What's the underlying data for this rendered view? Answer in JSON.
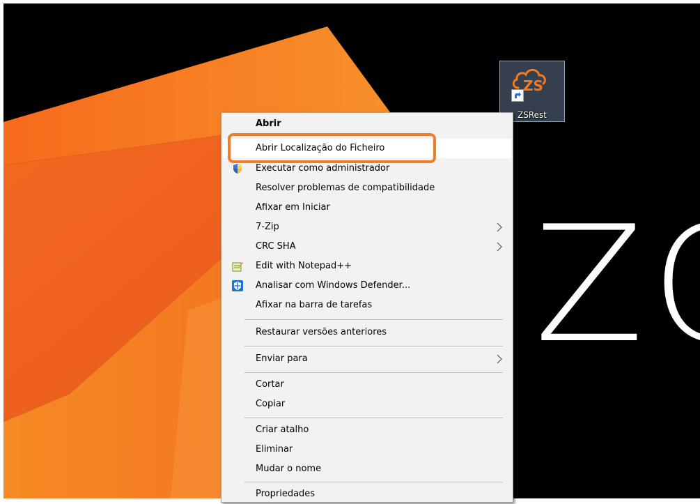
{
  "desktop": {
    "background_color": "#000000",
    "wallpaper_text": "ZC",
    "accent_color": "#f47a20",
    "shortcut": {
      "label": "ZSRest",
      "logo_text": "ZS",
      "icon": "zsrest-cloud-icon"
    }
  },
  "context_menu": {
    "items": [
      {
        "label": "Abrir",
        "bold": true
      },
      {
        "label": "Abrir Localização do Ficheiro",
        "hovered": true
      },
      {
        "label": "Executar como administrador",
        "icon": "uac-shield-icon"
      },
      {
        "label": "Resolver problemas de compatibilidade"
      },
      {
        "label": "Afixar em Iniciar"
      },
      {
        "label": "7-Zip",
        "submenu": true
      },
      {
        "label": "CRC SHA",
        "submenu": true
      },
      {
        "label": "Edit with Notepad++",
        "icon": "notepad-plus-plus-icon"
      },
      {
        "label": "Analisar com Windows Defender...",
        "icon": "windows-defender-icon"
      },
      {
        "label": "Afixar na barra de tarefas"
      },
      {
        "label": "Restaurar versões anteriores"
      },
      {
        "label": "Enviar para",
        "submenu": true
      },
      {
        "label": "Cortar"
      },
      {
        "label": "Copiar"
      },
      {
        "label": "Criar atalho"
      },
      {
        "label": "Eliminar"
      },
      {
        "label": "Mudar o nome"
      },
      {
        "label": "Propriedades"
      }
    ]
  },
  "annotation": {
    "highlight_color": "#ef7d2b",
    "highlighted_item": "Abrir Localização do Ficheiro"
  }
}
